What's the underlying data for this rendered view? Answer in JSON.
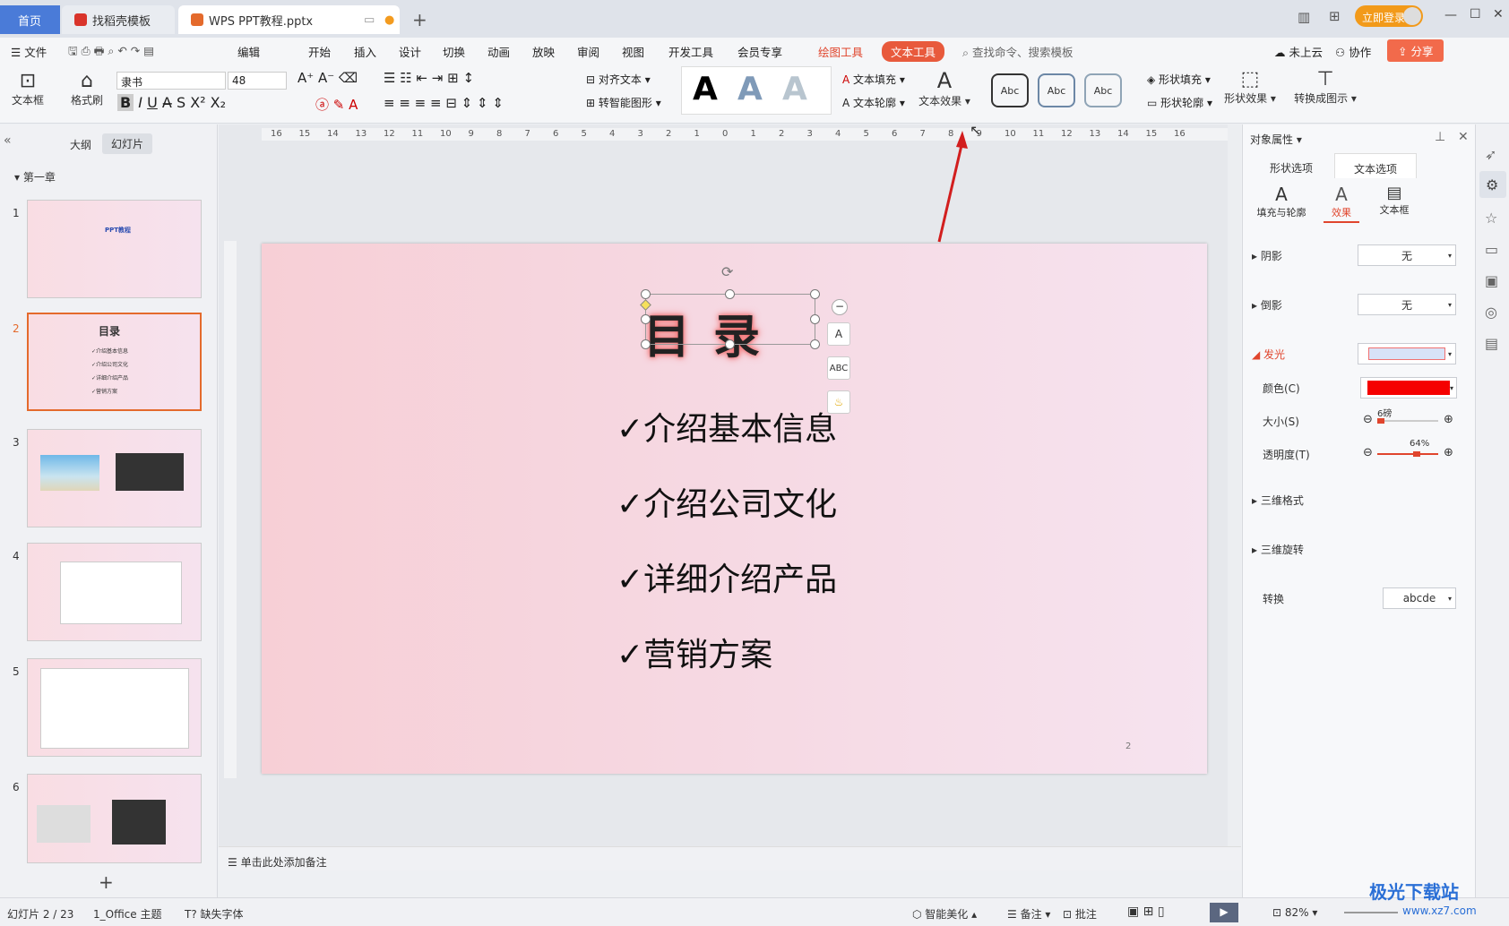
{
  "titlebar": {
    "home_tab": "首页",
    "tab1": "找稻壳模板",
    "tab2": "WPS PPT教程.pptx",
    "login": "立即登录"
  },
  "menu": {
    "file": "文件",
    "edit": "编辑",
    "items": [
      "开始",
      "插入",
      "设计",
      "切换",
      "动画",
      "放映",
      "审阅",
      "视图",
      "开发工具",
      "会员专享"
    ],
    "drawing_tools": "绘图工具",
    "text_tools": "文本工具",
    "search": "查找命令、搜索模板",
    "cloud": "未上云",
    "collab": "协作",
    "share": "分享"
  },
  "ribbon": {
    "textbox": "文本框",
    "format_painter": "格式刷",
    "font": "隶书",
    "size": "48",
    "align_text": "对齐文本",
    "smart_shape": "转智能图形",
    "text_fill": "文本填充",
    "text_outline": "文本轮廓",
    "text_effect": "文本效果",
    "abc": "Abc",
    "shape_fill": "形状填充",
    "shape_outline": "形状轮廓",
    "shape_effect": "形状效果",
    "convert": "转换成图示"
  },
  "leftpane": {
    "outline": "大纲",
    "slides": "幻灯片",
    "chapter": "第一章",
    "nums": [
      "1",
      "2",
      "3",
      "4",
      "5",
      "6"
    ]
  },
  "slide": {
    "title": "目录",
    "bullets": [
      "✓介绍基本信息",
      "✓介绍公司文化",
      "✓详细介绍产品",
      "✓营销方案"
    ],
    "page": "2",
    "thumb1_text": "PPT教程",
    "thumb2_title": "目录"
  },
  "notes": "单击此处添加备注",
  "rightpane": {
    "title": "对象属性",
    "tab_shape": "形状选项",
    "tab_text": "文本选项",
    "sub_fill": "填充与轮廓",
    "sub_effect": "效果",
    "sub_box": "文本框",
    "shadow": "阴影",
    "reflection": "倒影",
    "glow": "发光",
    "none": "无",
    "color": "颜色(C)",
    "size": "大小(S)",
    "size_val": "6磅",
    "transparency": "透明度(T)",
    "trans_val": "64%",
    "three_d_format": "三维格式",
    "three_d_rotate": "三维旋转",
    "transform": "转换",
    "transform_val": "abcde",
    "glow_color": "#f50000"
  },
  "status": {
    "slide": "幻灯片 2 / 23",
    "theme": "1_Office 主题",
    "missing_font": "缺失字体",
    "beautify": "智能美化",
    "notes": "备注",
    "comment": "批注",
    "zoom": "82%"
  },
  "ruler_labels": [
    "16",
    "15",
    "14",
    "13",
    "12",
    "11",
    "10",
    "9",
    "8",
    "7",
    "6",
    "5",
    "4",
    "3",
    "2",
    "1",
    "0",
    "1",
    "2",
    "3",
    "4",
    "5",
    "6",
    "7",
    "8",
    "9",
    "10",
    "11",
    "12",
    "13",
    "14",
    "15",
    "16"
  ],
  "watermark": "极光下载站",
  "watermark_url": "www.xz7.com"
}
